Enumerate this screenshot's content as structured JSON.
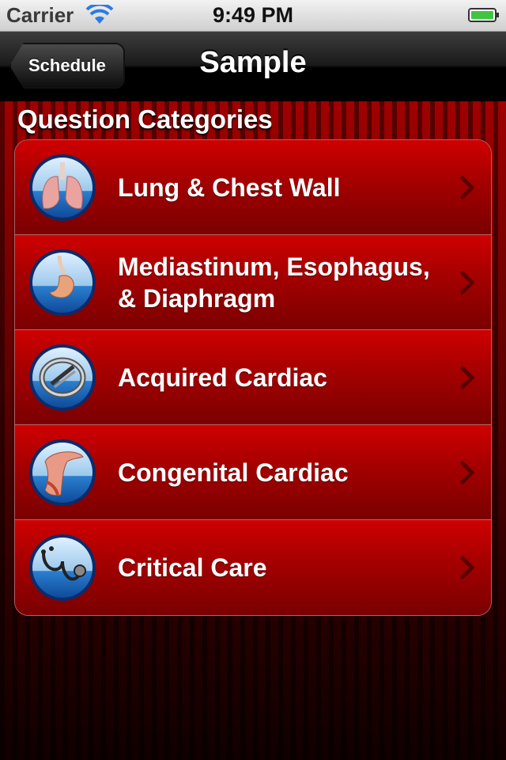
{
  "status_bar": {
    "carrier": "Carrier",
    "time": "9:49 PM",
    "battery_color": "#3fc53f"
  },
  "nav_bar": {
    "back_label": "Schedule",
    "title": "Sample"
  },
  "section": {
    "title": "Question Categories"
  },
  "categories": [
    {
      "label": "Lung & Chest Wall",
      "icon": "lungs-icon"
    },
    {
      "label": "Mediastinum, Esophagus, & Diaphragm",
      "icon": "stomach-icon"
    },
    {
      "label": "Acquired Cardiac",
      "icon": "heart-valve-icon"
    },
    {
      "label": "Congenital Cardiac",
      "icon": "aorta-icon"
    },
    {
      "label": "Critical Care",
      "icon": "stethoscope-icon"
    }
  ],
  "colors": {
    "accent_red": "#b00000",
    "icon_blue": "#1a6fc0"
  }
}
